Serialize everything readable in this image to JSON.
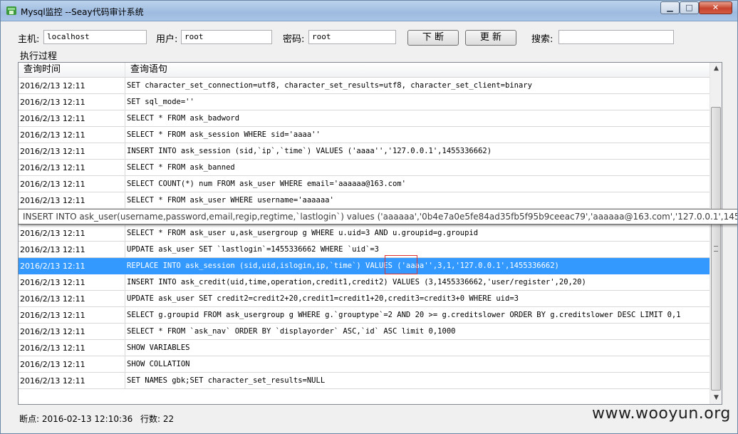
{
  "window": {
    "title": "Mysql监控 --Seay代码审计系统",
    "controls": {
      "minimize": "▁",
      "maximize": "□",
      "close": "✕"
    }
  },
  "connection": {
    "host_label": "主机:",
    "host_value": "localhost",
    "user_label": "用户:",
    "user_value": "root",
    "password_label": "密码:",
    "password_value": "root",
    "break_button": "下 断",
    "update_button": "更 新",
    "search_label": "搜索:",
    "search_value": ""
  },
  "log": {
    "group_label": "执行过程",
    "columns": [
      "查询时间",
      "查询语句"
    ],
    "selected_index": 10,
    "rows": [
      {
        "time": "2016/2/13 12:11",
        "query": "SET character_set_connection=utf8, character_set_results=utf8, character_set_client=binary"
      },
      {
        "time": "2016/2/13 12:11",
        "query": "SET sql_mode=''"
      },
      {
        "time": "2016/2/13 12:11",
        "query": "SELECT * FROM ask_badword"
      },
      {
        "time": "2016/2/13 12:11",
        "query": "SELECT * FROM ask_session WHERE sid='aaaa''"
      },
      {
        "time": "2016/2/13 12:11",
        "query": "INSERT INTO ask_session (sid,`ip`,`time`) VALUES ('aaaa'','127.0.0.1',1455336662)"
      },
      {
        "time": "2016/2/13 12:11",
        "query": "SELECT * FROM ask_banned"
      },
      {
        "time": "2016/2/13 12:11",
        "query": "SELECT COUNT(*) num FROM ask_user WHERE  email='aaaaaa@163.com'"
      },
      {
        "time": "2016/2/13 12:11",
        "query": "SELECT * FROM ask_user WHERE username='aaaaaa'"
      },
      {
        "time": "2016/2/13 12:11",
        "query": "SELECT * FROM ask_user u,ask_usergroup g WHERE u.uid=3 AND u.groupid=g.groupid"
      },
      {
        "time": "2016/2/13 12:11",
        "query": "UPDATE ask_user SET `lastlogin`=1455336662  WHERE `uid`=3"
      },
      {
        "time": "2016/2/13 12:11",
        "query": "REPLACE INTO ask_session (sid,uid,islogin,ip,`time`) VALUES ('aaaa'',3,1,'127.0.0.1',1455336662)"
      },
      {
        "time": "2016/2/13 12:11",
        "query": "INSERT INTO ask_credit(uid,time,operation,credit1,credit2) VALUES (3,1455336662,'user/register',20,20)"
      },
      {
        "time": "2016/2/13 12:11",
        "query": "UPDATE ask_user SET credit2=credit2+20,credit1=credit1+20,credit3=credit3+0 WHERE uid=3"
      },
      {
        "time": "2016/2/13 12:11",
        "query": "SELECT g.groupid FROM ask_usergroup g WHERE  g.`grouptype`=2  AND 20 >= g.creditslower ORDER BY g.creditslower DESC LIMIT 0,1"
      },
      {
        "time": "2016/2/13 12:11",
        "query": "SELECT * FROM `ask_nav` ORDER BY `displayorder` ASC,`id` ASC limit 0,1000"
      },
      {
        "time": "2016/2/13 12:11",
        "query": "SHOW VARIABLES"
      },
      {
        "time": "2016/2/13 12:11",
        "query": "SHOW COLLATION"
      },
      {
        "time": "2016/2/13 12:11",
        "query": "SET NAMES gbk;SET character_set_results=NULL"
      }
    ],
    "tooltip": "INSERT INTO ask_user(username,password,email,regip,regtime,`lastlogin`) values ('aaaaaa','0b4e7a0e5fe84ad35fb5f95b9ceeac79','aaaaaa@163.com','127.0.0.1',1455336662,"
  },
  "status": {
    "breakpoint": "断点: 2016-02-13 12:10:36",
    "row_count": "行数: 22"
  },
  "watermark": "www.wooyun.org",
  "colors": {
    "selection": "#3399ff",
    "highlight_box": "#e03030"
  }
}
